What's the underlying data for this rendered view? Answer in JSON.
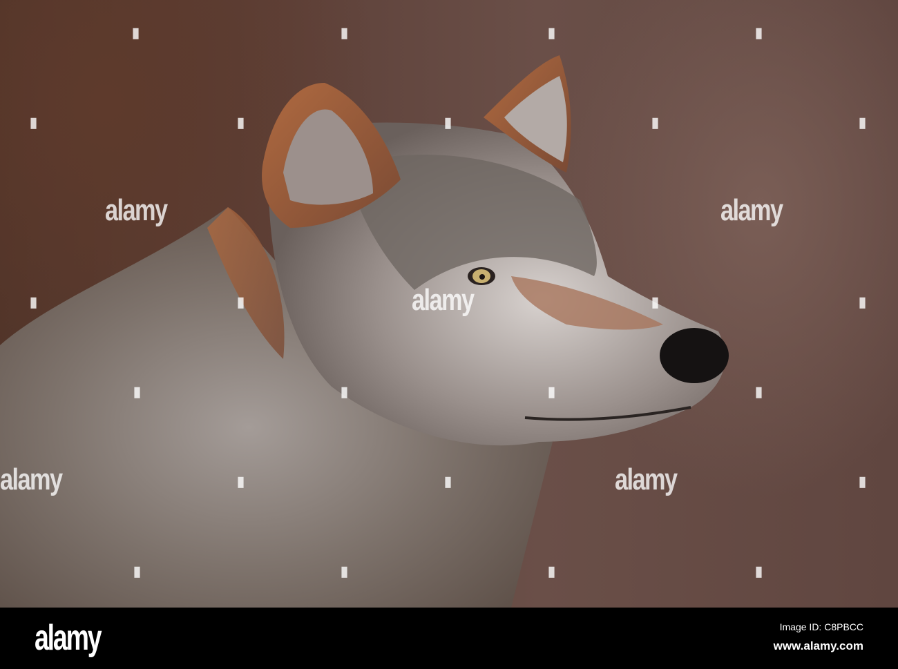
{
  "watermark": {
    "text": "alamy"
  },
  "footer": {
    "logo": "alamy",
    "image_id": "Image ID: C8PBCC",
    "url": "www.alamy.com"
  },
  "colors": {
    "background": "#5d4038",
    "fur_gray": "#8a8480",
    "fur_rust": "#a0603a",
    "footer": "#000000"
  }
}
